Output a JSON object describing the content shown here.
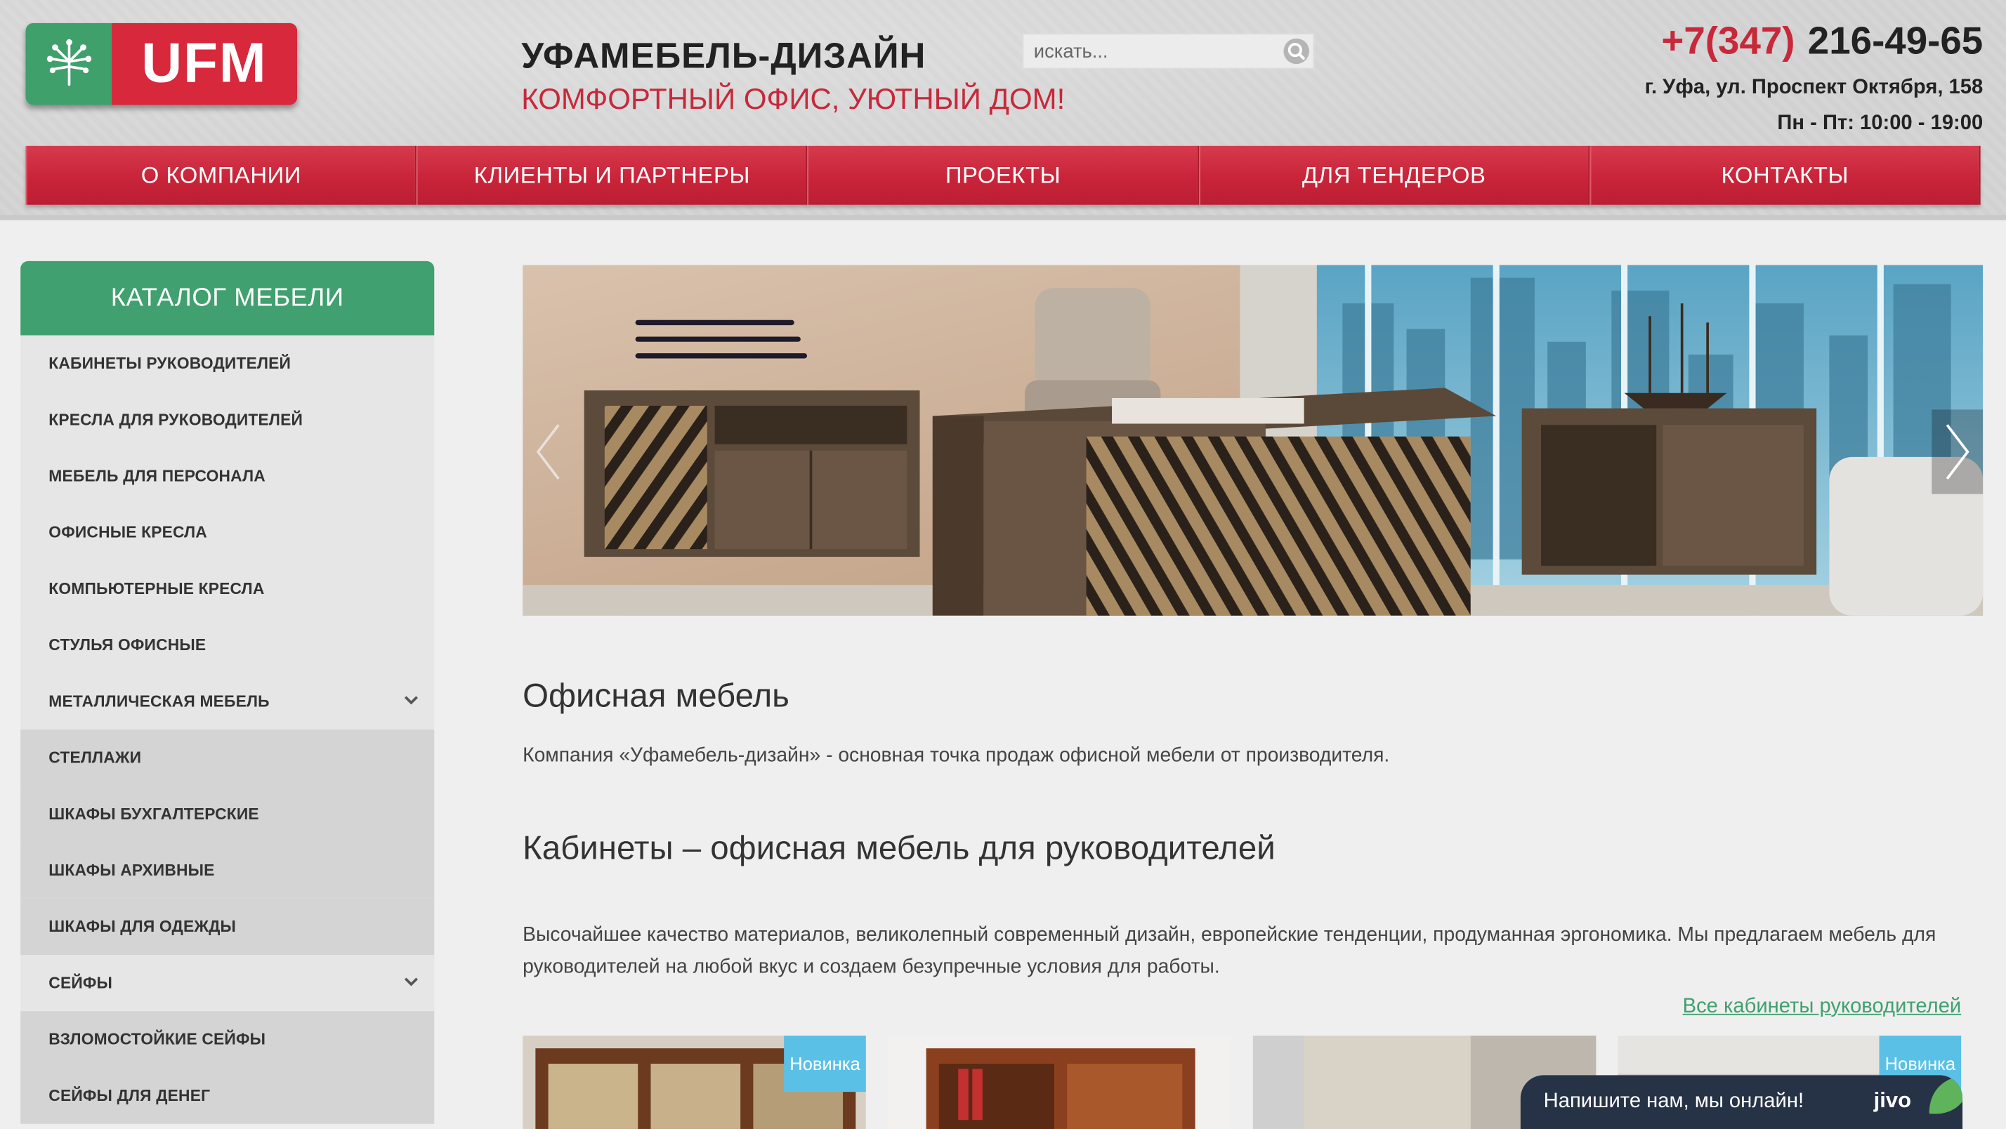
{
  "header": {
    "logo_text": "UFM",
    "title": "УФАМЕБЕЛЬ-ДИЗАЙН",
    "tagline": "КОМФОРТНЫЙ ОФИС, УЮТНЫЙ ДОМ!",
    "search_placeholder": "искать...",
    "phone_code": "+7(347)",
    "phone_number": "216-49-65",
    "address": "г. Уфа, ул. Проспект Октября, 158",
    "hours": "Пн - Пт: 10:00 - 19:00"
  },
  "nav": {
    "items": [
      "О КОМПАНИИ",
      "КЛИЕНТЫ И ПАРТНЕРЫ",
      "ПРОЕКТЫ",
      "ДЛЯ ТЕНДЕРОВ",
      "КОНТАКТЫ"
    ]
  },
  "catalog": {
    "title": "КАТАЛОГ МЕБЕЛИ",
    "items": [
      "КАБИНЕТЫ РУКОВОДИТЕЛЕЙ",
      "КРЕСЛА ДЛЯ РУКОВОДИТЕЛЕЙ",
      "МЕБЕЛЬ ДЛЯ ПЕРСОНАЛА",
      "ОФИСНЫЕ КРЕСЛА",
      "КОМПЬЮТЕРНЫЕ КРЕСЛА",
      "СТУЛЬЯ ОФИСНЫЕ",
      "МЕТАЛЛИЧЕСКАЯ МЕБЕЛЬ",
      "СТЕЛЛАЖИ",
      "ШКАФЫ БУХГАЛТЕРСКИЕ",
      "ШКАФЫ АРХИВНЫЕ",
      "ШКАФЫ ДЛЯ ОДЕЖДЫ",
      "СЕЙФЫ",
      "ВЗЛОМОСТОЙКИЕ СЕЙФЫ",
      "СЕЙФЫ ДЛЯ ДЕНЕГ"
    ]
  },
  "content": {
    "heading1": "Офисная мебель",
    "paragraph1": "Компания «Уфамебель-дизайн» - основная точка продаж офисной мебели от производителя.",
    "heading2": "Кабинеты – офисная мебель для руководителей",
    "paragraph2": "Высочайшее качество материалов, великолепный современный дизайн, европейские тенденции, продуманная эргономика. Мы предлагаем мебель для руководителей на любой вкус и создаем безупречные условия для работы.",
    "all_link": "Все кабинеты руководителей"
  },
  "products": {
    "badge": "Новинка"
  },
  "chat": {
    "text": "Напишите нам, мы онлайн!",
    "brand": "jivo"
  },
  "colors": {
    "brand_red": "#c7283a",
    "brand_green": "#41a06f",
    "badge_blue": "#5bc0e6"
  }
}
